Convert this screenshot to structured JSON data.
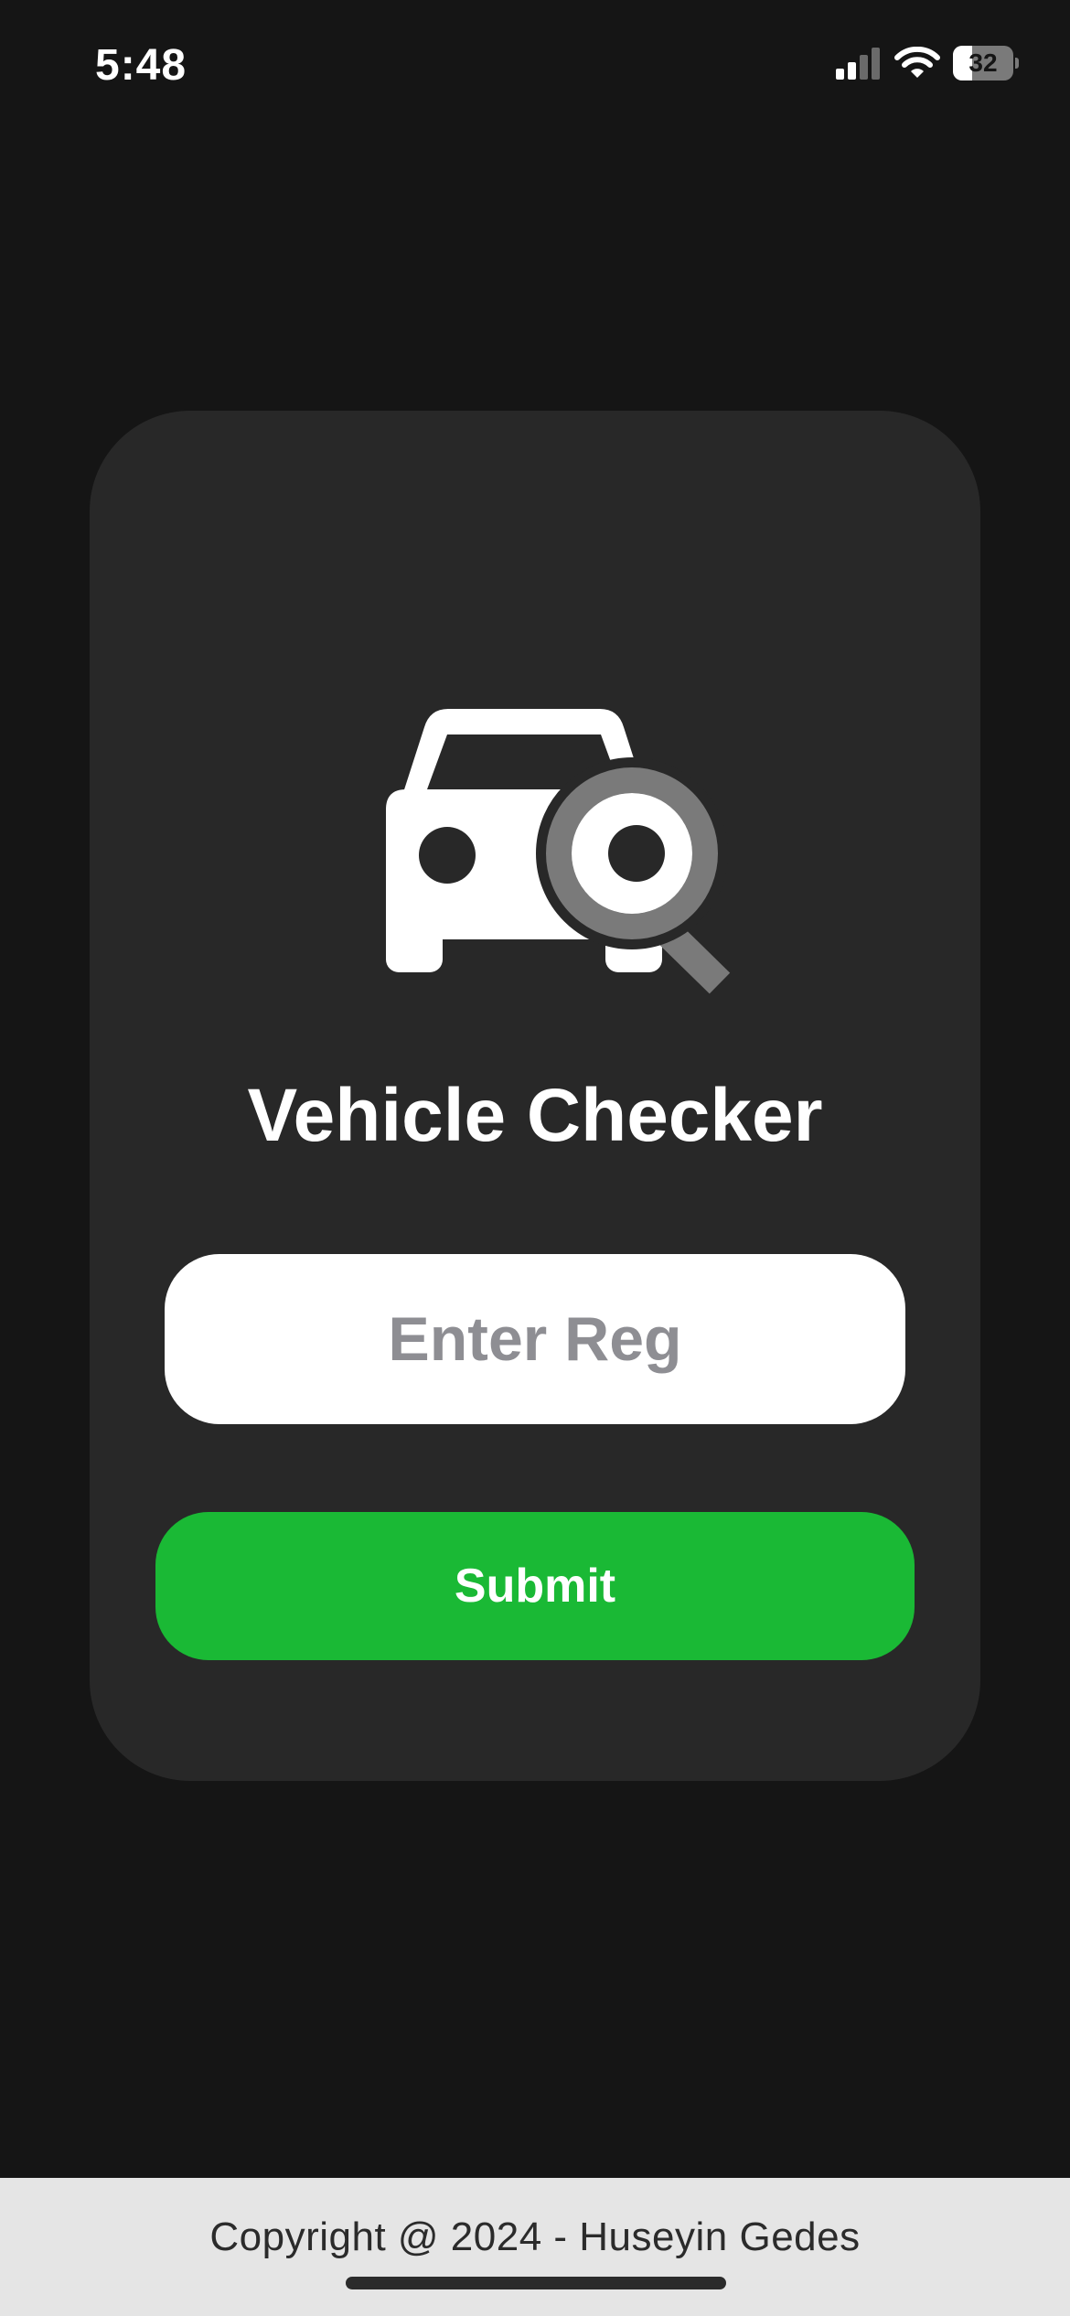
{
  "status_bar": {
    "time": "5:48",
    "battery_percent": "32",
    "battery_level": 0.32,
    "signal_bars_active": 2,
    "icons": [
      "cellular-signal-icon",
      "wifi-icon",
      "battery-icon"
    ]
  },
  "app": {
    "logo_icon": "car-search-icon",
    "title": "Vehicle Checker",
    "reg_input": {
      "value": "",
      "placeholder": "Enter Reg"
    },
    "submit_label": "Submit"
  },
  "footer": {
    "copyright": "Copyright @ 2024 - Huseyin Gedes"
  },
  "colors": {
    "background": "#151515",
    "card": "#282828",
    "accent_green": "#1ab935",
    "magnifier_gray": "#7a7a7a",
    "footer_bg": "#e5e5e5",
    "placeholder_gray": "#8e8e93"
  }
}
